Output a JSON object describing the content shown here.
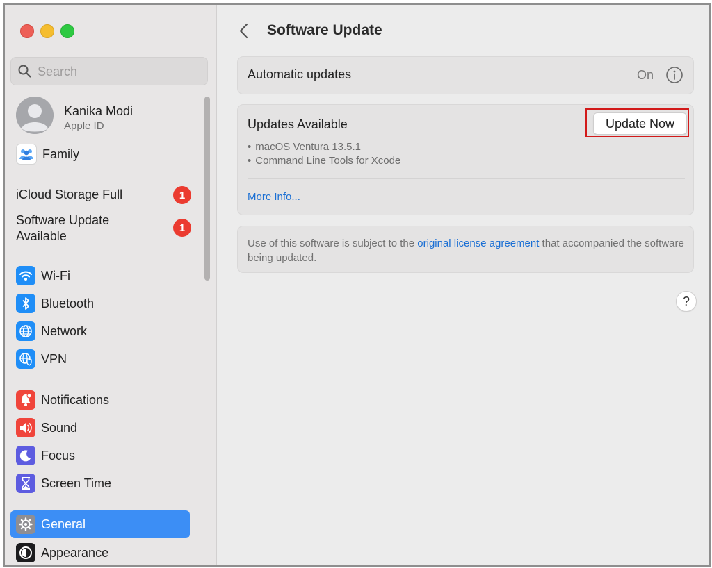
{
  "window": {
    "controls": [
      "close",
      "minimize",
      "zoom"
    ]
  },
  "sidebar": {
    "search": {
      "placeholder": "Search",
      "value": ""
    },
    "account": {
      "name": "Kanika Modi",
      "subtitle": "Apple ID"
    },
    "family": {
      "label": "Family",
      "icon": "family-icon"
    },
    "alerts": [
      {
        "label": "iCloud Storage Full",
        "badge": "1"
      },
      {
        "label": "Software Update Available",
        "badge": "1"
      }
    ],
    "items": [
      {
        "label": "Wi-Fi",
        "icon": "wifi-icon",
        "color": "#1f8ef7"
      },
      {
        "label": "Bluetooth",
        "icon": "bluetooth-icon",
        "color": "#1f8ef7"
      },
      {
        "label": "Network",
        "icon": "globe-icon",
        "color": "#1f8ef7"
      },
      {
        "label": "VPN",
        "icon": "vpn-globe-icon",
        "color": "#1f8ef7"
      },
      {
        "label": "Notifications",
        "icon": "bell-icon",
        "color": "#f0453b"
      },
      {
        "label": "Sound",
        "icon": "speaker-icon",
        "color": "#f0453b"
      },
      {
        "label": "Focus",
        "icon": "moon-icon",
        "color": "#5d5ce0"
      },
      {
        "label": "Screen Time",
        "icon": "hourglass-icon",
        "color": "#5d5ce0"
      },
      {
        "label": "General",
        "icon": "gear-icon",
        "color": "#8e8e93",
        "active": true
      },
      {
        "label": "Appearance",
        "icon": "appearance-icon",
        "color": "#1c1c1e"
      }
    ]
  },
  "main": {
    "title": "Software Update",
    "automatic_updates": {
      "label": "Automatic updates",
      "value": "On"
    },
    "updates": {
      "title": "Updates Available",
      "button_label": "Update Now",
      "items": [
        "macOS Ventura 13.5.1",
        "Command Line Tools for Xcode"
      ],
      "bullet": "•",
      "more_info": "More Info..."
    },
    "license": {
      "prefix": "Use of this software is subject to the ",
      "link": "original license agreement",
      "suffix": " that accompanied the software being updated."
    },
    "help": "?"
  },
  "colors": {
    "accent": "#3c8ef5",
    "link": "#1a6fd4",
    "badge": "#eb3b30",
    "highlight_outline": "#d21a1a"
  }
}
